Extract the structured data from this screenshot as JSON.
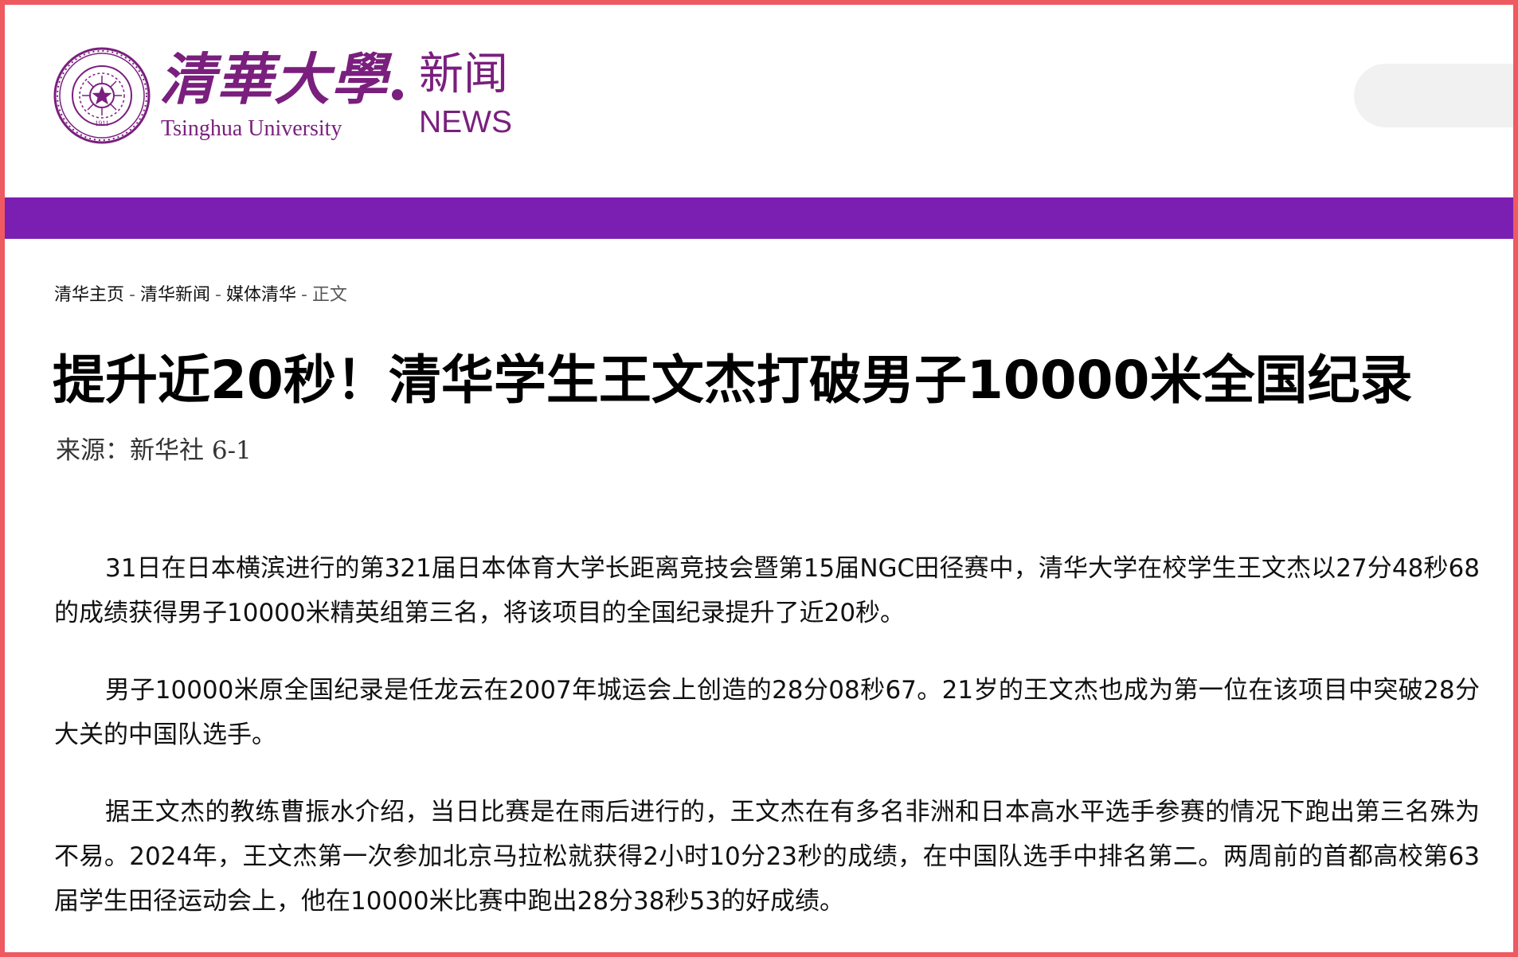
{
  "header": {
    "logo": {
      "name_cn": "清華大學",
      "name_en": "Tsinghua University",
      "seal_year": "1911"
    },
    "section": {
      "cn": "新闻",
      "en": "NEWS"
    }
  },
  "colors": {
    "brand_purple": "#7a1f7e",
    "nav_bar": "#7a1fb2",
    "frame": "#ee5a60",
    "search_bg": "#f1f1f1"
  },
  "breadcrumb": {
    "items": [
      "清华主页",
      "清华新闻",
      "媒体清华"
    ],
    "current": "正文",
    "separator": "-"
  },
  "article": {
    "title": "提升近20秒！清华学生王文杰打破男子10000米全国纪录",
    "source": "来源：新华社 6-1",
    "paragraphs": [
      "31日在日本横滨进行的第321届日本体育大学长距离竞技会暨第15届NGC田径赛中，清华大学在校学生王文杰以27分48秒68的成绩获得男子10000米精英组第三名，将该项目的全国纪录提升了近20秒。",
      "男子10000米原全国纪录是任龙云在2007年城运会上创造的28分08秒67。21岁的王文杰也成为第一位在该项目中突破28分大关的中国队选手。",
      "据王文杰的教练曹振水介绍，当日比赛是在雨后进行的，王文杰在有多名非洲和日本高水平选手参赛的情况下跑出第三名殊为不易。2024年，王文杰第一次参加北京马拉松就获得2小时10分23秒的成绩，在中国队选手中排名第二。两周前的首都高校第63届学生田径运动会上，他在10000米比赛中跑出28分38秒53的好成绩。"
    ]
  }
}
